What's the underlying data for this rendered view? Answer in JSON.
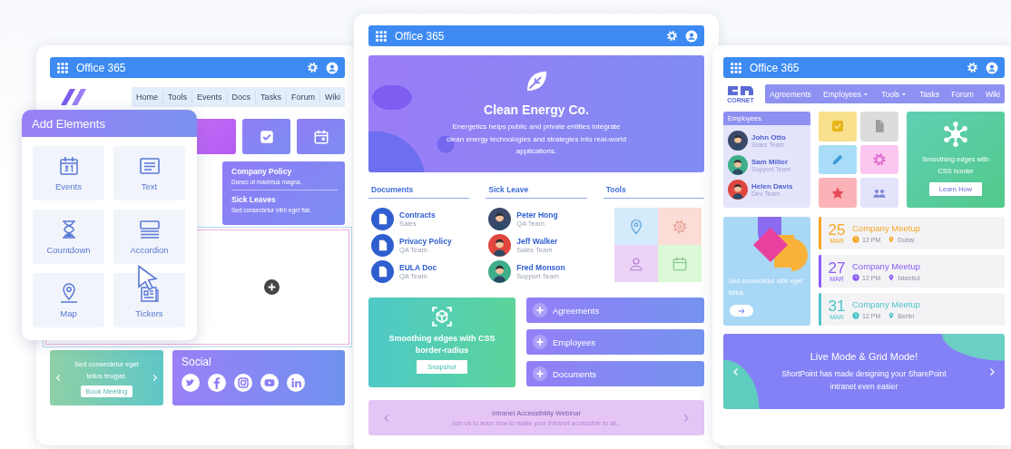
{
  "left_page": {
    "header": {
      "title": "Office 365"
    },
    "nav": [
      "Home",
      "Tools",
      "Events",
      "Docs",
      "Tasks",
      "Forum",
      "Wiki"
    ],
    "notices": [
      {
        "title": "Company Policy",
        "text": "Donec ut maximus magna."
      },
      {
        "title": "Sick Leaves",
        "text": "Sed consectetur nibh eget fiat."
      }
    ],
    "slider": {
      "text": "Sed consectetur eget tellus feugiat.",
      "button": "Book Meeting"
    },
    "social": {
      "title": "Social"
    }
  },
  "add_elements": {
    "title": "Add Elements",
    "items": [
      {
        "label": "Events",
        "kind": "calendar"
      },
      {
        "label": "Text",
        "kind": "text"
      },
      {
        "label": "Countdown",
        "kind": "countdown"
      },
      {
        "label": "Accordion",
        "kind": "accordion"
      },
      {
        "label": "Map",
        "kind": "map"
      },
      {
        "label": "Tickers",
        "kind": "tickers"
      }
    ]
  },
  "center_page": {
    "header": {
      "title": "Office 365"
    },
    "hero": {
      "title": "Clean Energy Co.",
      "text": "Energetics helps public and private entities integrate clean energy technologies and strategies into real-world applications."
    },
    "documents": {
      "title": "Documents",
      "items": [
        {
          "name": "Contracts",
          "team": "Sales"
        },
        {
          "name": "Privacy Policy",
          "team": "QA Team"
        },
        {
          "name": "EULA Doc",
          "team": "QA Team"
        }
      ]
    },
    "sick_leave": {
      "title": "Sick Leave",
      "people": [
        {
          "name": "Peter Hong",
          "team": "QA Team",
          "color": "#3b4a6b"
        },
        {
          "name": "Jeff Walker",
          "team": "Sales Team",
          "color": "#e0463f"
        },
        {
          "name": "Fred Monson",
          "team": "Support Team",
          "color": "#3fae8a"
        }
      ]
    },
    "tools": {
      "title": "Tools"
    },
    "promo": {
      "text": "Smoothing edges with CSS border-radius",
      "button": "Snapshot"
    },
    "links": [
      "Agreements",
      "Employees",
      "Documents"
    ],
    "webinar": {
      "title": "Intranet Accessibility Webinar",
      "text": "Join us to learn how to make your Intranet accessible to all..."
    }
  },
  "right_page": {
    "header": {
      "title": "Office 365"
    },
    "logo": {
      "text": "CORNET"
    },
    "nav": [
      {
        "label": "Agreements",
        "dropdown": false
      },
      {
        "label": "Employees",
        "dropdown": true
      },
      {
        "label": "Tools",
        "dropdown": true
      },
      {
        "label": "Tasks",
        "dropdown": false
      },
      {
        "label": "Forum",
        "dropdown": false
      },
      {
        "label": "Wiki",
        "dropdown": false
      }
    ],
    "employees": {
      "title": "Employees",
      "people": [
        {
          "name": "John Otto",
          "team": "Sales Team",
          "color": "#3b4a6b"
        },
        {
          "name": "Sam Miller",
          "team": "Support Team",
          "color": "#3fae8a"
        },
        {
          "name": "Helen Davis",
          "team": "Dev Team",
          "color": "#e0463f"
        }
      ]
    },
    "promo": {
      "text": "Smoothing edges with CSS border",
      "button": "Learn How"
    },
    "card": {
      "text": "Sed consectetur nibh eget tellus."
    },
    "events": [
      {
        "day": "25",
        "month": "MAR",
        "title": "Company Meetup",
        "time": "12 PM",
        "place": "Dubai",
        "color": "#f5a623"
      },
      {
        "day": "27",
        "month": "MAR",
        "title": "Company Meetup",
        "time": "12 PM",
        "place": "Istanbul",
        "color": "#8b5cf6"
      },
      {
        "day": "31",
        "month": "MAR",
        "title": "Company Meetup",
        "time": "12 PM",
        "place": "Berlin",
        "color": "#4fc3c9"
      }
    ],
    "banner": {
      "title": "Live Mode & Grid Mode!",
      "text": "ShortPoint has made designing your SharePoint intranet even easier"
    }
  }
}
